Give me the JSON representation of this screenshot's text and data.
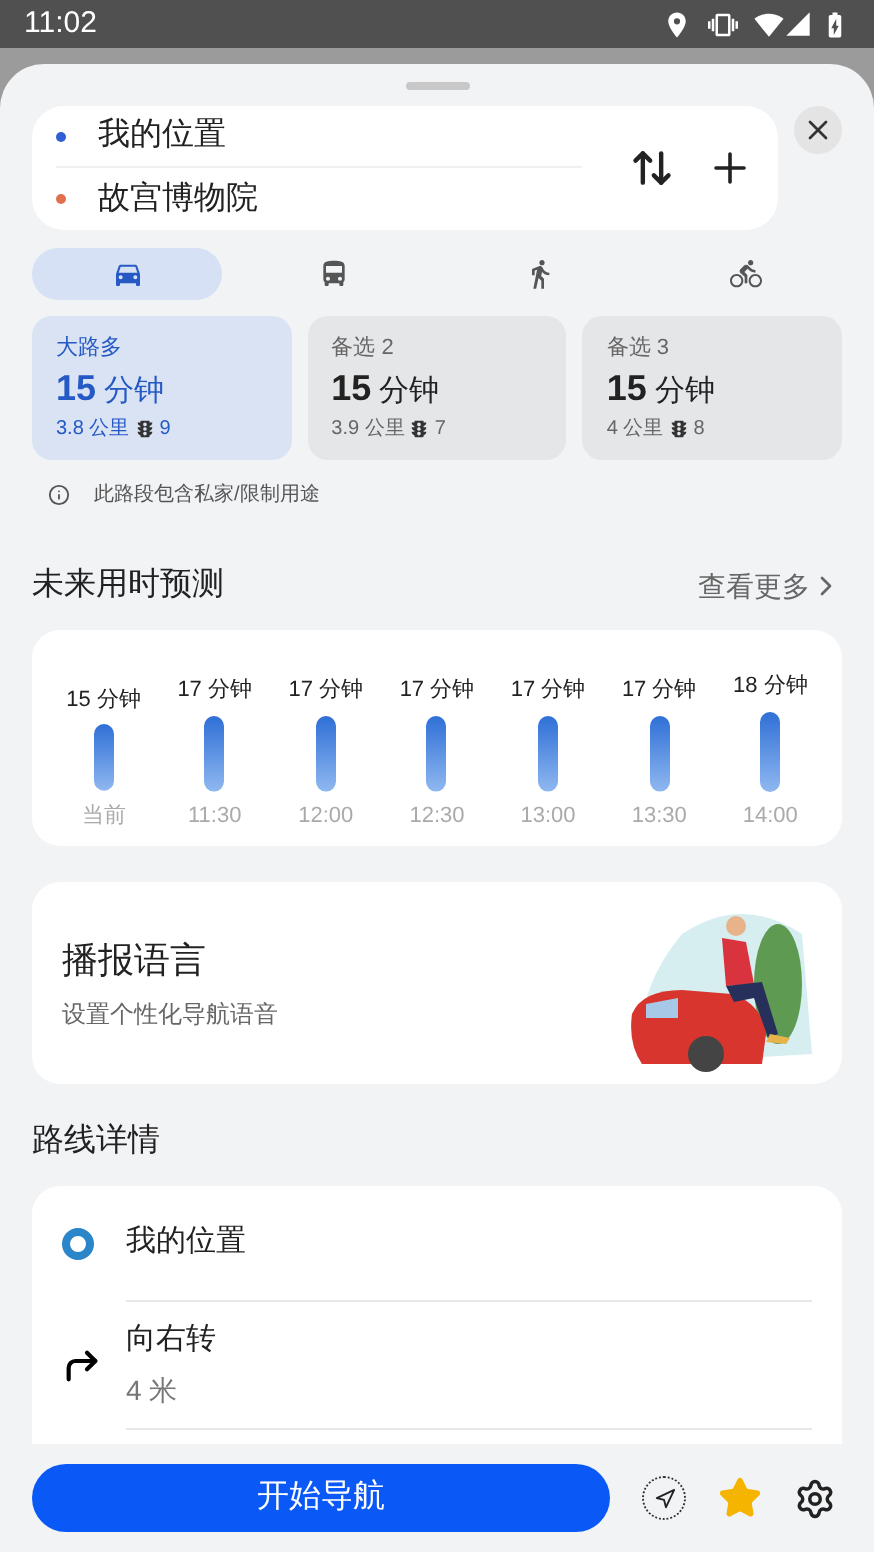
{
  "status_bar": {
    "time": "11:02"
  },
  "route_inputs": [
    {
      "text": "我的位置",
      "color": "#2f5fd0"
    },
    {
      "text": "故宫博物院",
      "color": "#e0704f"
    }
  ],
  "modes": [
    {
      "kind": "car",
      "selected": true
    },
    {
      "kind": "bus",
      "selected": false
    },
    {
      "kind": "walk",
      "selected": false
    },
    {
      "kind": "bike",
      "selected": false
    }
  ],
  "routes": [
    {
      "label": "大路多",
      "time_value": "15",
      "time_unit": "分钟",
      "distance": "3.8 公里",
      "lights": "9",
      "selected": true
    },
    {
      "label": "备选 2",
      "time_value": "15",
      "time_unit": "分钟",
      "distance": "3.9 公里",
      "lights": "7",
      "selected": false
    },
    {
      "label": "备选 3",
      "time_value": "15",
      "time_unit": "分钟",
      "distance": "4 公里",
      "lights": "8",
      "selected": false
    }
  ],
  "notice": "此路段包含私家/限制用途",
  "forecast": {
    "title": "未来用时预测",
    "more": "查看更多",
    "chart_data": {
      "type": "bar",
      "categories": [
        "当前",
        "11:30",
        "12:00",
        "12:30",
        "13:00",
        "13:30",
        "14:00"
      ],
      "values": [
        15,
        17,
        17,
        17,
        17,
        17,
        18
      ],
      "value_labels": [
        "15 分钟",
        "17 分钟",
        "17 分钟",
        "17 分钟",
        "17 分钟",
        "17 分钟",
        "18 分钟"
      ]
    }
  },
  "voice": {
    "title": "播报语言",
    "subtitle": "设置个性化导航语音"
  },
  "details": {
    "title": "路线详情",
    "steps": [
      {
        "kind": "start",
        "text": "我的位置"
      },
      {
        "kind": "turn_right",
        "text": "向右转",
        "distance": "4 米"
      }
    ]
  },
  "bottom": {
    "start_button": "开始导航",
    "favorite": true
  }
}
